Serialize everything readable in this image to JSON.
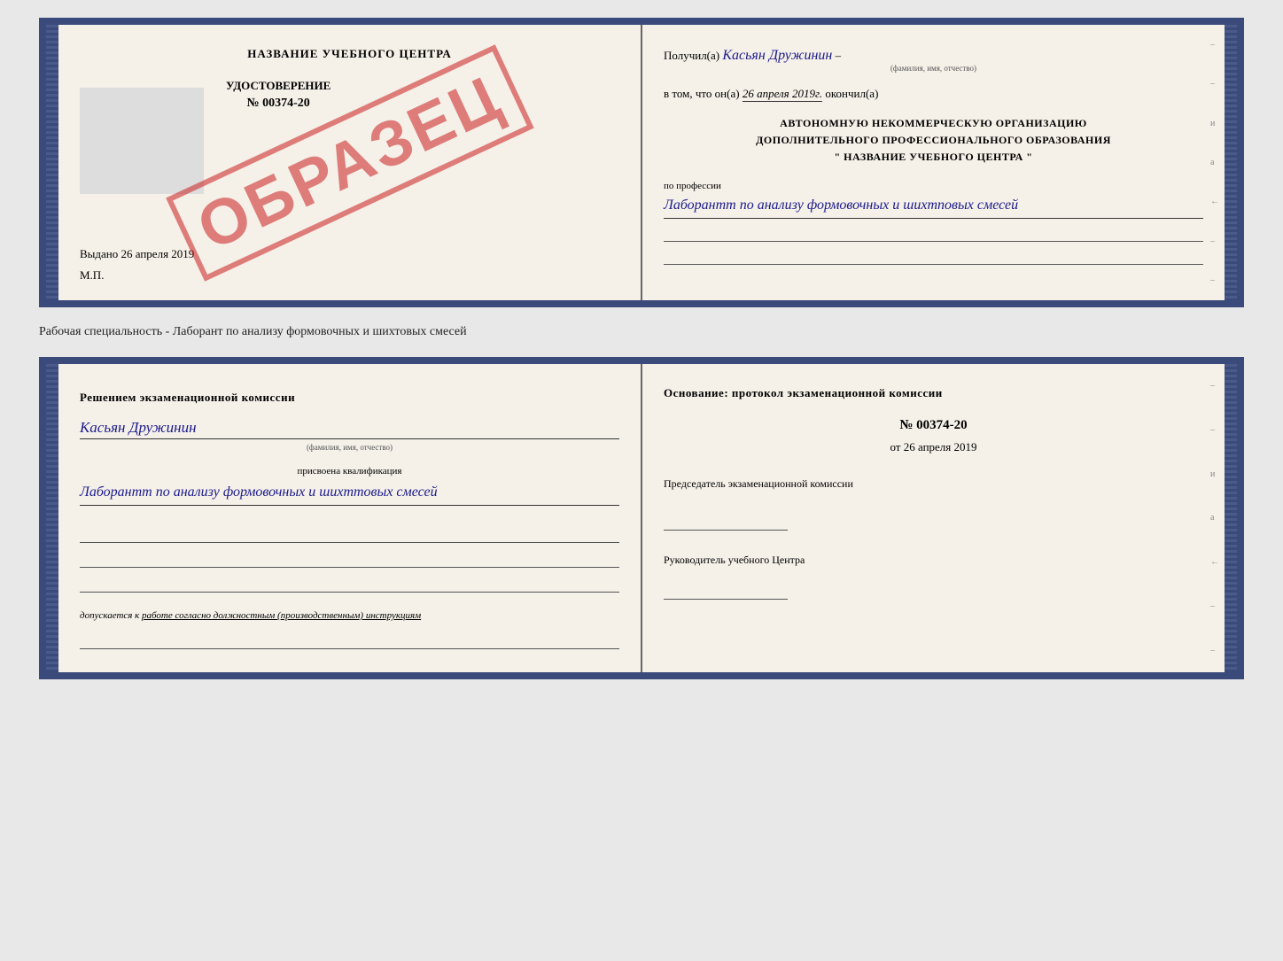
{
  "doc1": {
    "left": {
      "title": "НАЗВАНИЕ УЧЕБНОГО ЦЕНТРА",
      "cert_label": "УДОСТОВЕРЕНИЕ",
      "cert_number": "№ 00374-20",
      "issued_prefix": "Выдано",
      "issued_date": "26 апреля 2019",
      "mp_label": "М.П.",
      "stamp": "ОБРАЗЕЦ"
    },
    "right": {
      "received_prefix": "Получил(а)",
      "received_name": "Касьян Дружинин",
      "name_sublabel": "(фамилия, имя, отчество)",
      "date_prefix": "в том, что он(а)",
      "date_value": "26 апреля 2019г.",
      "date_suffix": "окончил(а)",
      "org_line1": "АВТОНОМНУЮ НЕКОММЕРЧЕСКУЮ ОРГАНИЗАЦИЮ",
      "org_line2": "ДОПОЛНИТЕЛЬНОГО ПРОФЕССИОНАЛЬНОГО ОБРАЗОВАНИЯ",
      "org_line3": "\" НАЗВАНИЕ УЧЕБНОГО ЦЕНТРА \"",
      "profession_label": "по профессии",
      "profession_value": "Лаборантт по анализу формовочных и шихтповых смесей"
    }
  },
  "section_label": "Рабочая специальность - Лаборант по анализу формовочных и шихтовых смесей",
  "doc2": {
    "left": {
      "commission_title": "Решением экзаменационной комиссии",
      "person_name": "Касьян Дружинин",
      "name_sublabel": "(фамилия, имя, отчество)",
      "qualification_label": "присвоена квалификация",
      "qualification_value": "Лаборантт по анализу формовочных и шихттовых смесей",
      "допускается_prefix": "допускается к",
      "допускается_value": "работе согласно должностным (производственным) инструкциям"
    },
    "right": {
      "basis_title": "Основание: протокол экзаменационной комиссии",
      "protocol_number": "№ 00374-20",
      "date_prefix": "от",
      "date_value": "26 апреля 2019",
      "chairman_label": "Председатель экзаменационной комиссии",
      "head_label": "Руководитель учебного Центра"
    }
  }
}
